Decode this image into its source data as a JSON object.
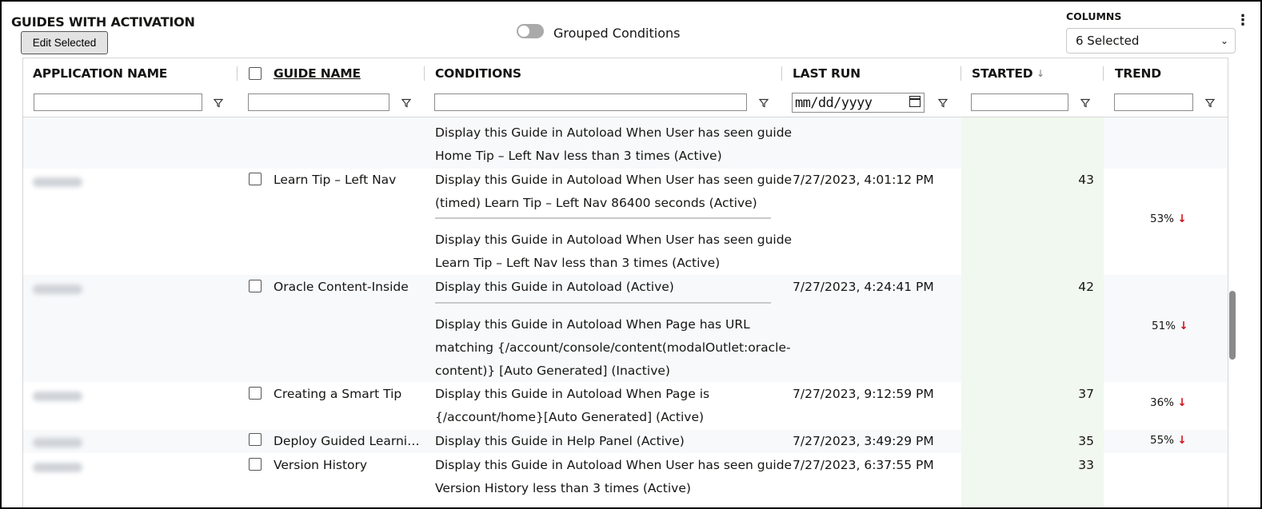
{
  "title": "GUIDES WITH ACTIVATION",
  "edit_selected": "Edit Selected",
  "toggle_label": "Grouped Conditions",
  "columns": {
    "label": "COLUMNS",
    "selected": "6 Selected"
  },
  "headers": {
    "application_name": "APPLICATION NAME",
    "guide_name": "GUIDE NAME",
    "conditions": "CONDITIONS",
    "last_run": "LAST RUN",
    "started": "STARTED",
    "trend": "TREND"
  },
  "date_placeholder": "mm/dd/yyyy",
  "partial_row": {
    "conditions": [
      "Display this Guide in Autoload When User has seen guide",
      "Home Tip – Left Nav less than 3 times (Active)"
    ]
  },
  "rows": [
    {
      "guide": "Learn Tip – Left Nav",
      "cond1": [
        "Display this Guide in Autoload When User has seen guide",
        "(timed) Learn Tip – Left Nav 86400 seconds (Active)"
      ],
      "cond2": [
        "Display this Guide in Autoload When User has seen guide",
        "Learn Tip – Left Nav less than 3 times (Active)"
      ],
      "last_run": "7/27/2023, 4:01:12 PM",
      "started": "43",
      "trend": "53%"
    },
    {
      "guide": "Oracle Content-Inside",
      "cond1": [
        "Display this Guide in Autoload (Active)"
      ],
      "cond2": [
        "Display this Guide in Autoload When Page has URL",
        "matching {/account/console/content(modalOutlet:oracle-",
        "content)} [Auto Generated] (Inactive)"
      ],
      "last_run": "7/27/2023, 4:24:41 PM",
      "started": "42",
      "trend": "51%"
    },
    {
      "guide": "Creating a Smart Tip",
      "cond1": [
        "Display this Guide in Autoload When Page is",
        "{/account/home}[Auto Generated] (Active)"
      ],
      "last_run": "7/27/2023, 9:12:59 PM",
      "started": "37",
      "trend": "36%"
    },
    {
      "guide": "Deploy Guided Learni…",
      "cond1": [
        "Display this Guide in Help Panel (Active)"
      ],
      "last_run": "7/27/2023, 3:49:29 PM",
      "started": "35",
      "trend": "55%"
    },
    {
      "guide": "Version History",
      "cond1": [
        "Display this Guide in Autoload When User has seen guide",
        "Version History less than 3 times (Active)"
      ],
      "last_run": "7/27/2023, 6:37:55 PM",
      "started": "33",
      "trend": ""
    }
  ],
  "icons": {
    "filter": "filter-icon",
    "sort": "sort-down-icon",
    "trend_down": "arrow-down-icon",
    "kebab": "more-vertical-icon",
    "chevron": "chevron-down-icon",
    "calendar": "calendar-icon"
  }
}
